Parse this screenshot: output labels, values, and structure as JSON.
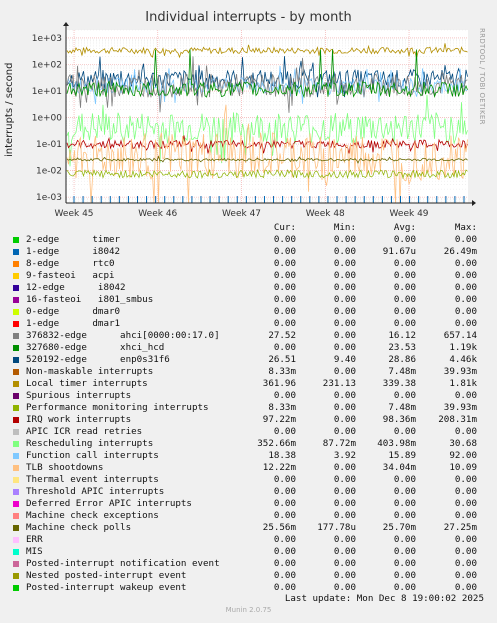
{
  "chart_data": {
    "type": "line",
    "title": "Individual interrupts - by month",
    "ylabel": "interrupts / second",
    "yscale": "log",
    "ylim": [
      0.0006,
      2000
    ],
    "yticks": [
      {
        "value": 1000,
        "label": "1e+03"
      },
      {
        "value": 100,
        "label": "1e+02"
      },
      {
        "value": 10,
        "label": "1e+01"
      },
      {
        "value": 1,
        "label": "1e+00"
      },
      {
        "value": 0.1,
        "label": "1e-01"
      },
      {
        "value": 0.01,
        "label": "1e-02"
      },
      {
        "value": 0.001,
        "label": "1e-03"
      }
    ],
    "xticks": [
      "Week 45",
      "Week 46",
      "Week 47",
      "Week 48",
      "Week 49"
    ],
    "grid": true,
    "side_tag": "RRDTOOL / TOBI OETIKER",
    "legend_headers": {
      "cur": "Cur:",
      "min": "Min:",
      "avg": "Avg:",
      "max": "Max:"
    },
    "series": [
      {
        "name": "2-edge      timer",
        "color": "#00cc00",
        "cur": "0.00",
        "min": "0.00",
        "avg": "0.00",
        "max": "0.00"
      },
      {
        "name": "1-edge      i8042",
        "color": "#0066b3",
        "cur": "0.00",
        "min": "0.00",
        "avg": "91.67u",
        "max": "26.49m"
      },
      {
        "name": "8-edge      rtc0",
        "color": "#ff8000",
        "cur": "0.00",
        "min": "0.00",
        "avg": "0.00",
        "max": "0.00"
      },
      {
        "name": "9-fasteoi   acpi",
        "color": "#ffcc00",
        "cur": "0.00",
        "min": "0.00",
        "avg": "0.00",
        "max": "0.00"
      },
      {
        "name": "12-edge      i8042",
        "color": "#330099",
        "cur": "0.00",
        "min": "0.00",
        "avg": "0.00",
        "max": "0.00"
      },
      {
        "name": "16-fasteoi   i801_smbus",
        "color": "#990099",
        "cur": "0.00",
        "min": "0.00",
        "avg": "0.00",
        "max": "0.00"
      },
      {
        "name": "0-edge      dmar0",
        "color": "#ccff00",
        "cur": "0.00",
        "min": "0.00",
        "avg": "0.00",
        "max": "0.00"
      },
      {
        "name": "1-edge      dmar1",
        "color": "#ff0000",
        "cur": "0.00",
        "min": "0.00",
        "avg": "0.00",
        "max": "0.00"
      },
      {
        "name": "376832-edge      ahci[0000:00:17.0]",
        "color": "#808080",
        "cur": "27.52",
        "min": "0.00",
        "avg": "16.12",
        "max": "657.14"
      },
      {
        "name": "327680-edge      xhci_hcd",
        "color": "#008f00",
        "cur": "0.00",
        "min": "0.00",
        "avg": "23.53",
        "max": "1.19k"
      },
      {
        "name": "520192-edge      enp0s31f6",
        "color": "#00487d",
        "cur": "26.51",
        "min": "9.40",
        "avg": "28.86",
        "max": "4.46k"
      },
      {
        "name": "Non-maskable interrupts",
        "color": "#b35a00",
        "cur": "8.33m",
        "min": "0.00",
        "avg": "7.48m",
        "max": "39.93m"
      },
      {
        "name": "Local timer interrupts",
        "color": "#b38f00",
        "cur": "361.96",
        "min": "231.13",
        "avg": "339.38",
        "max": "1.81k"
      },
      {
        "name": "Spurious interrupts",
        "color": "#6b006b",
        "cur": "0.00",
        "min": "0.00",
        "avg": "0.00",
        "max": "0.00"
      },
      {
        "name": "Performance monitoring interrupts",
        "color": "#8fb300",
        "cur": "8.33m",
        "min": "0.00",
        "avg": "7.48m",
        "max": "39.93m"
      },
      {
        "name": "IRQ work interrupts",
        "color": "#b30000",
        "cur": "97.22m",
        "min": "0.00",
        "avg": "98.36m",
        "max": "208.31m"
      },
      {
        "name": "APIC ICR read retries",
        "color": "#bebebe",
        "cur": "0.00",
        "min": "0.00",
        "avg": "0.00",
        "max": "0.00"
      },
      {
        "name": "Rescheduling interrupts",
        "color": "#80ff80",
        "cur": "352.66m",
        "min": "87.72m",
        "avg": "403.98m",
        "max": "30.68"
      },
      {
        "name": "Function call interrupts",
        "color": "#80c9ff",
        "cur": "18.38",
        "min": "3.92",
        "avg": "15.89",
        "max": "92.00"
      },
      {
        "name": "TLB shootdowns",
        "color": "#ffc080",
        "cur": "12.22m",
        "min": "0.00",
        "avg": "34.04m",
        "max": "10.09"
      },
      {
        "name": "Thermal event interrupts",
        "color": "#ffe680",
        "cur": "0.00",
        "min": "0.00",
        "avg": "0.00",
        "max": "0.00"
      },
      {
        "name": "Threshold APIC interrupts",
        "color": "#aa80ff",
        "cur": "0.00",
        "min": "0.00",
        "avg": "0.00",
        "max": "0.00"
      },
      {
        "name": "Deferred Error APIC interrupts",
        "color": "#ee00cc",
        "cur": "0.00",
        "min": "0.00",
        "avg": "0.00",
        "max": "0.00"
      },
      {
        "name": "Machine check exceptions",
        "color": "#ff8080",
        "cur": "0.00",
        "min": "0.00",
        "avg": "0.00",
        "max": "0.00"
      },
      {
        "name": "Machine check polls",
        "color": "#666600",
        "cur": "25.56m",
        "min": "177.78u",
        "avg": "25.70m",
        "max": "27.25m"
      },
      {
        "name": "ERR",
        "color": "#ffbfff",
        "cur": "0.00",
        "min": "0.00",
        "avg": "0.00",
        "max": "0.00"
      },
      {
        "name": "MIS",
        "color": "#00ffcc",
        "cur": "0.00",
        "min": "0.00",
        "avg": "0.00",
        "max": "0.00"
      },
      {
        "name": "Posted-interrupt notification event",
        "color": "#cc6699",
        "cur": "0.00",
        "min": "0.00",
        "avg": "0.00",
        "max": "0.00"
      },
      {
        "name": "Nested posted-interrupt event",
        "color": "#999900",
        "cur": "0.00",
        "min": "0.00",
        "avg": "0.00",
        "max": "0.00"
      },
      {
        "name": "Posted-interrupt wakeup event",
        "color": "#00cc00",
        "cur": "0.00",
        "min": "0.00",
        "avg": "0.00",
        "max": "0.00"
      }
    ]
  },
  "last_update": "Last update: Mon Dec  8 19:00:02 2025",
  "footer": "Munin 2.0.75"
}
